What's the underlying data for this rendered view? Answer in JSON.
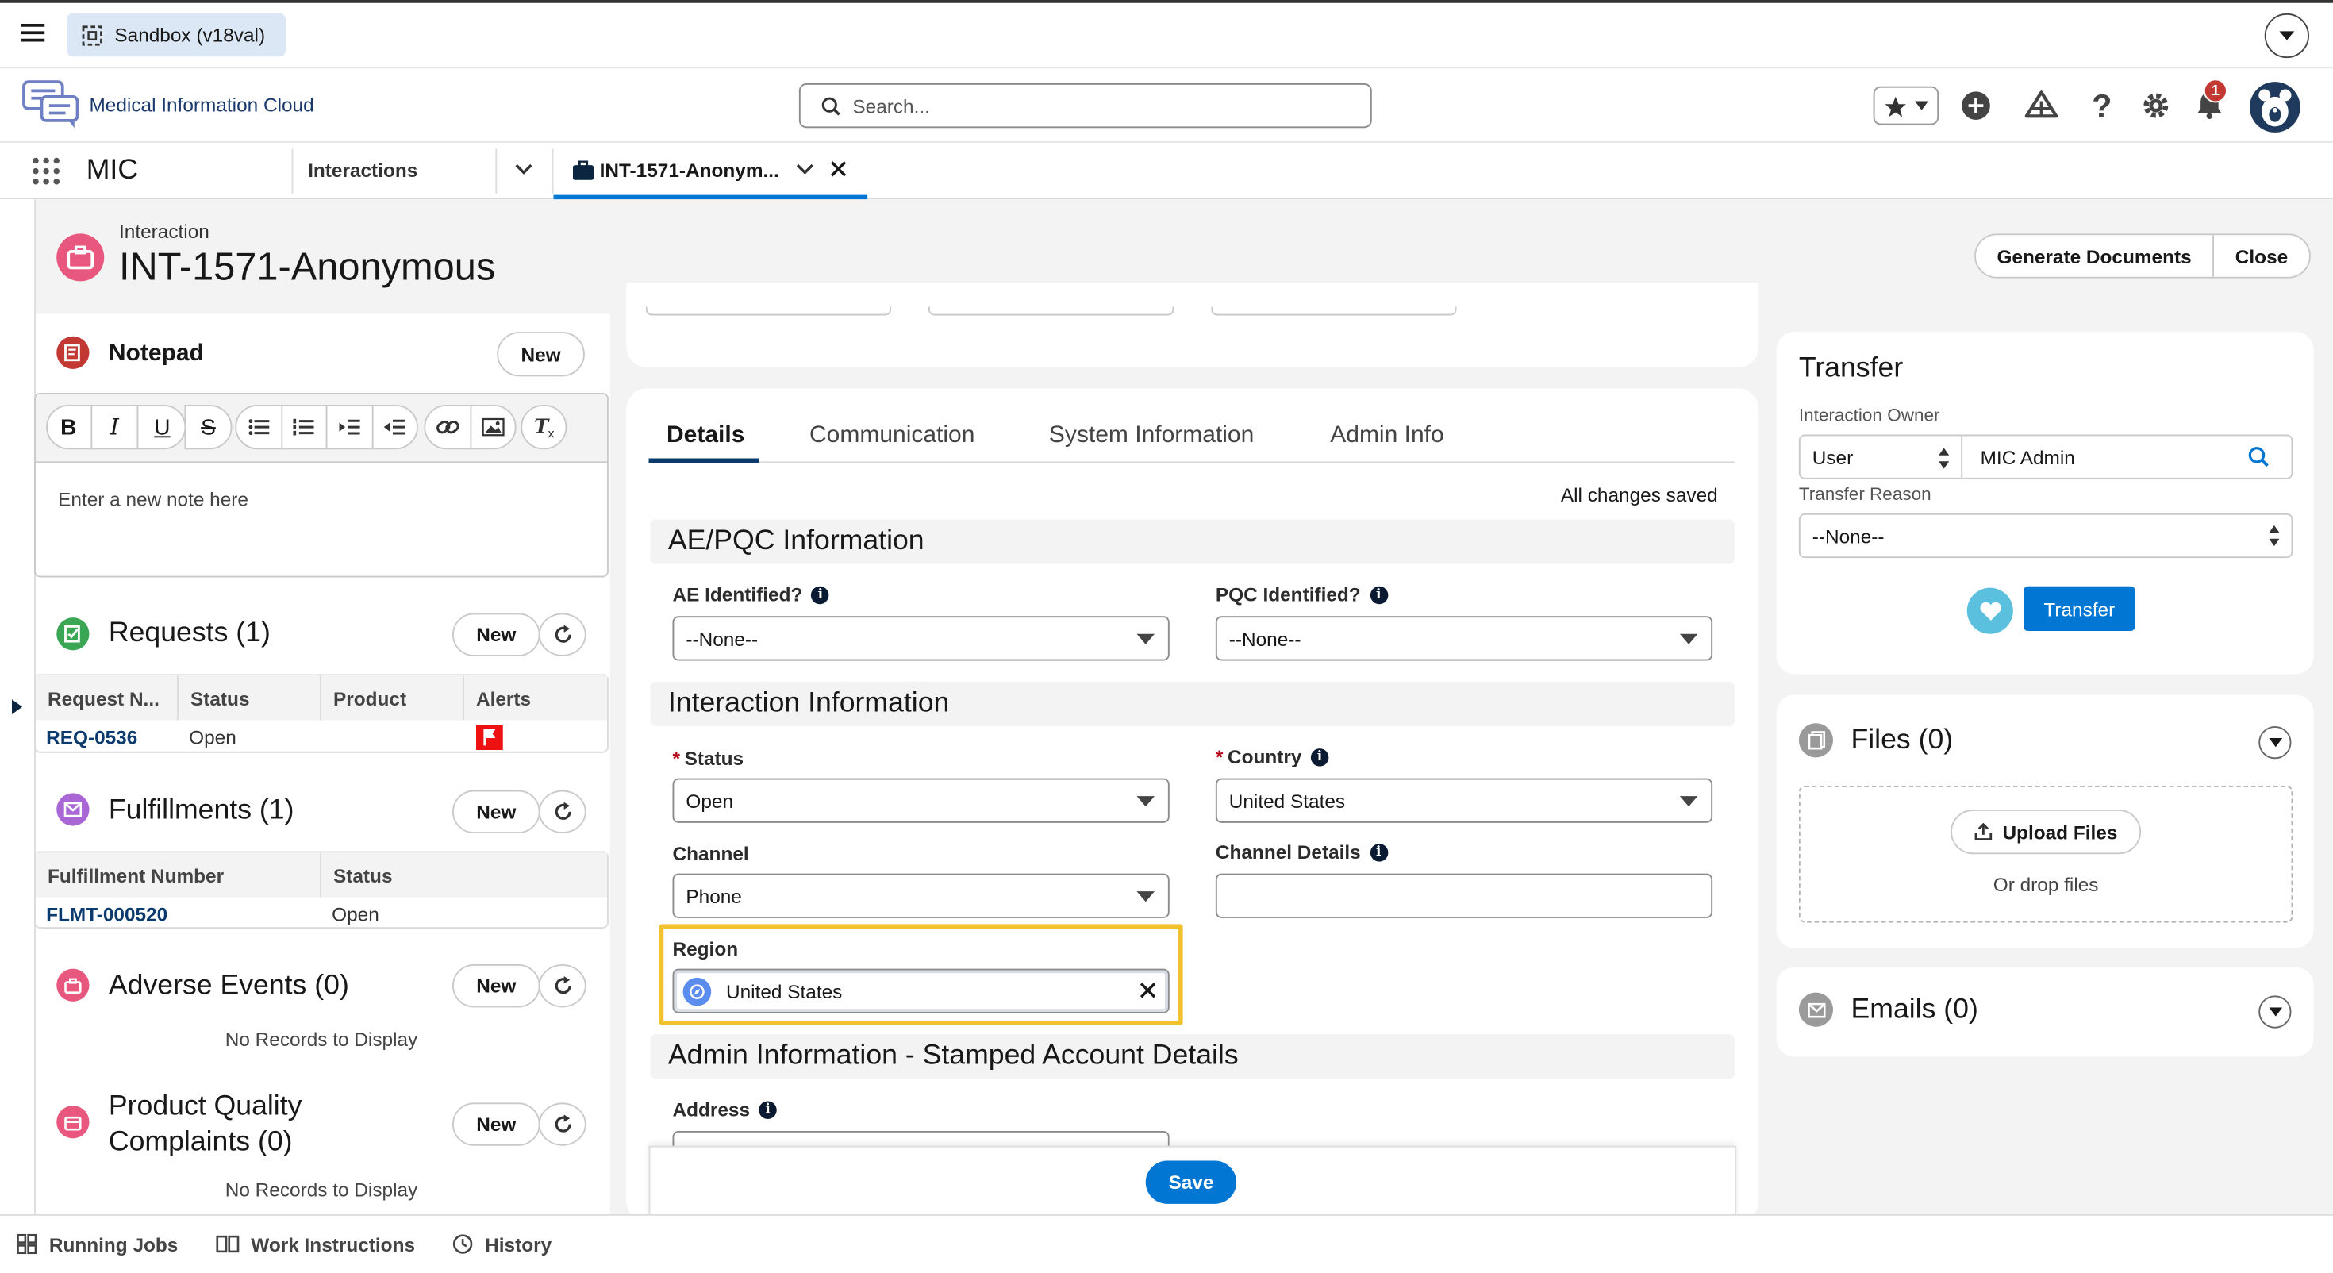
{
  "env": {
    "sandbox": "Sandbox (v18val)"
  },
  "app": {
    "brand": "Medical Information Cloud",
    "name": "MIC"
  },
  "search": {
    "placeholder": "Search..."
  },
  "notifications": {
    "count": "1"
  },
  "nav": {
    "tab1": "Interactions",
    "tab2": "INT-1571-Anonym..."
  },
  "record": {
    "type": "Interaction",
    "name": "INT-1571-Anonymous",
    "btn_generate": "Generate Documents",
    "btn_close": "Close"
  },
  "notepad": {
    "title": "Notepad",
    "new_label": "New",
    "placeholder": "Enter a new note here",
    "toolbar": [
      "B",
      "I",
      "U",
      "S"
    ]
  },
  "requests": {
    "title": "Requests (1)",
    "new_label": "New",
    "columns": [
      "Request N...",
      "Status",
      "Product",
      "Alerts"
    ],
    "rows": [
      {
        "id": "REQ-0536",
        "status": "Open",
        "product": ""
      }
    ]
  },
  "fulfillments": {
    "title": "Fulfillments (1)",
    "new_label": "New",
    "columns": [
      "Fulfillment Number",
      "Status"
    ],
    "rows": [
      {
        "id": "FLMT-000520",
        "status": "Open"
      }
    ]
  },
  "adverse": {
    "title": "Adverse Events (0)",
    "new_label": "New",
    "empty": "No Records to Display"
  },
  "pqc": {
    "title_line1": "Product Quality",
    "title_line2": "Complaints (0)",
    "new_label": "New",
    "empty": "No Records to Display"
  },
  "tabs": {
    "details": "Details",
    "communication": "Communication",
    "system": "System Information",
    "admin": "Admin Info",
    "status": "All changes saved"
  },
  "sections": {
    "aepqc": "AE/PQC Information",
    "interaction": "Interaction Information",
    "admin": "Admin Information - Stamped Account Details"
  },
  "fields": {
    "ae": {
      "label": "AE Identified?",
      "value": "--None--"
    },
    "pqc": {
      "label": "PQC Identified?",
      "value": "--None--"
    },
    "status": {
      "label": "Status",
      "value": "Open"
    },
    "country": {
      "label": "Country",
      "value": "United States"
    },
    "channel": {
      "label": "Channel",
      "value": "Phone"
    },
    "channel_details": {
      "label": "Channel Details",
      "value": ""
    },
    "region": {
      "label": "Region",
      "value": "United States"
    },
    "address": {
      "label": "Address"
    }
  },
  "save_label": "Save",
  "transfer": {
    "title": "Transfer",
    "owner_label": "Interaction Owner",
    "owner_type": "User",
    "owner_value": "MIC Admin",
    "reason_label": "Transfer Reason",
    "reason_value": "--None--",
    "btn": "Transfer"
  },
  "files": {
    "title": "Files (0)",
    "upload": "Upload Files",
    "drop": "Or drop files"
  },
  "emails": {
    "title": "Emails (0)"
  },
  "footer": {
    "running": "Running Jobs",
    "work": "Work Instructions",
    "history": "History"
  },
  "colors": {
    "brand": "#0176d3",
    "highlight": "#f2c12e",
    "notepad_icon": "#c23934",
    "requests_icon": "#3ba755",
    "fulfill_icon": "#a967d6",
    "adverse_icon": "#e8577d",
    "record_icon": "#e8577d",
    "heart": "#5bc0de"
  }
}
